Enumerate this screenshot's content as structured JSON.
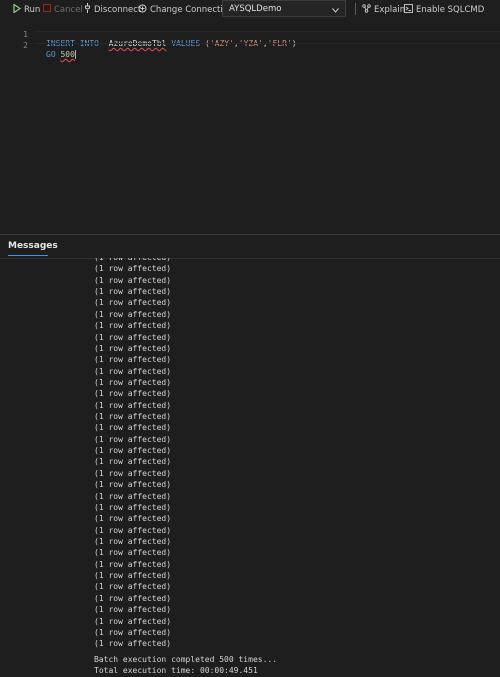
{
  "toolbar": {
    "run_label": "Run",
    "cancel_label": "Cancel",
    "disconnect_label": "Disconnect",
    "change_connection_label": "Change Connection",
    "database_selected": "AYSQLDemo",
    "explain_label": "Explain",
    "enable_sqlcmd_label": "Enable SQLCMD",
    "icons": {
      "run": "play-icon",
      "cancel": "stop-icon",
      "disconnect": "disconnect-icon",
      "change_connection": "connection-icon",
      "dropdown": "chevron-down-icon",
      "explain": "explain-icon",
      "enable_sqlcmd": "sqlcmd-icon"
    }
  },
  "editor": {
    "lines": [
      {
        "number": "1",
        "tokens": {
          "kw1": "INSERT",
          "kw2": "INTO",
          "table": "AzureDemoTbl",
          "kw3": "VALUES",
          "open": "(",
          "s1": "'AZY'",
          "c1": ",",
          "s2": "'YZA'",
          "c2": ",",
          "s3": "'FLR'",
          "close": ")"
        }
      },
      {
        "number": "2",
        "tokens": {
          "kw": "GO",
          "num": "500"
        }
      }
    ]
  },
  "results": {
    "tab_label": "Messages",
    "row_messages": [
      "(1 row affected)",
      "(1 row affected)",
      "(1 row affected)",
      "(1 row affected)",
      "(1 row affected)",
      "(1 row affected)",
      "(1 row affected)",
      "(1 row affected)",
      "(1 row affected)",
      "(1 row affected)",
      "(1 row affected)",
      "(1 row affected)",
      "(1 row affected)",
      "(1 row affected)",
      "(1 row affected)",
      "(1 row affected)",
      "(1 row affected)",
      "(1 row affected)",
      "(1 row affected)",
      "(1 row affected)",
      "(1 row affected)",
      "(1 row affected)",
      "(1 row affected)",
      "(1 row affected)",
      "(1 row affected)",
      "(1 row affected)",
      "(1 row affected)",
      "(1 row affected)",
      "(1 row affected)",
      "(1 row affected)",
      "(1 row affected)",
      "(1 row affected)",
      "(1 row affected)",
      "(1 row affected)",
      "(1 row affected)"
    ],
    "batch_message": "Batch execution completed 500 times...",
    "time_message": "Total execution time: 00:00:49.451"
  },
  "colors": {
    "background": "#1e1e1e",
    "keyword": "#569cd6",
    "string": "#ce9178",
    "number": "#b5cea8",
    "run_green": "#89d185",
    "cancel_red": "#a1260d",
    "accent": "#3794ff"
  }
}
